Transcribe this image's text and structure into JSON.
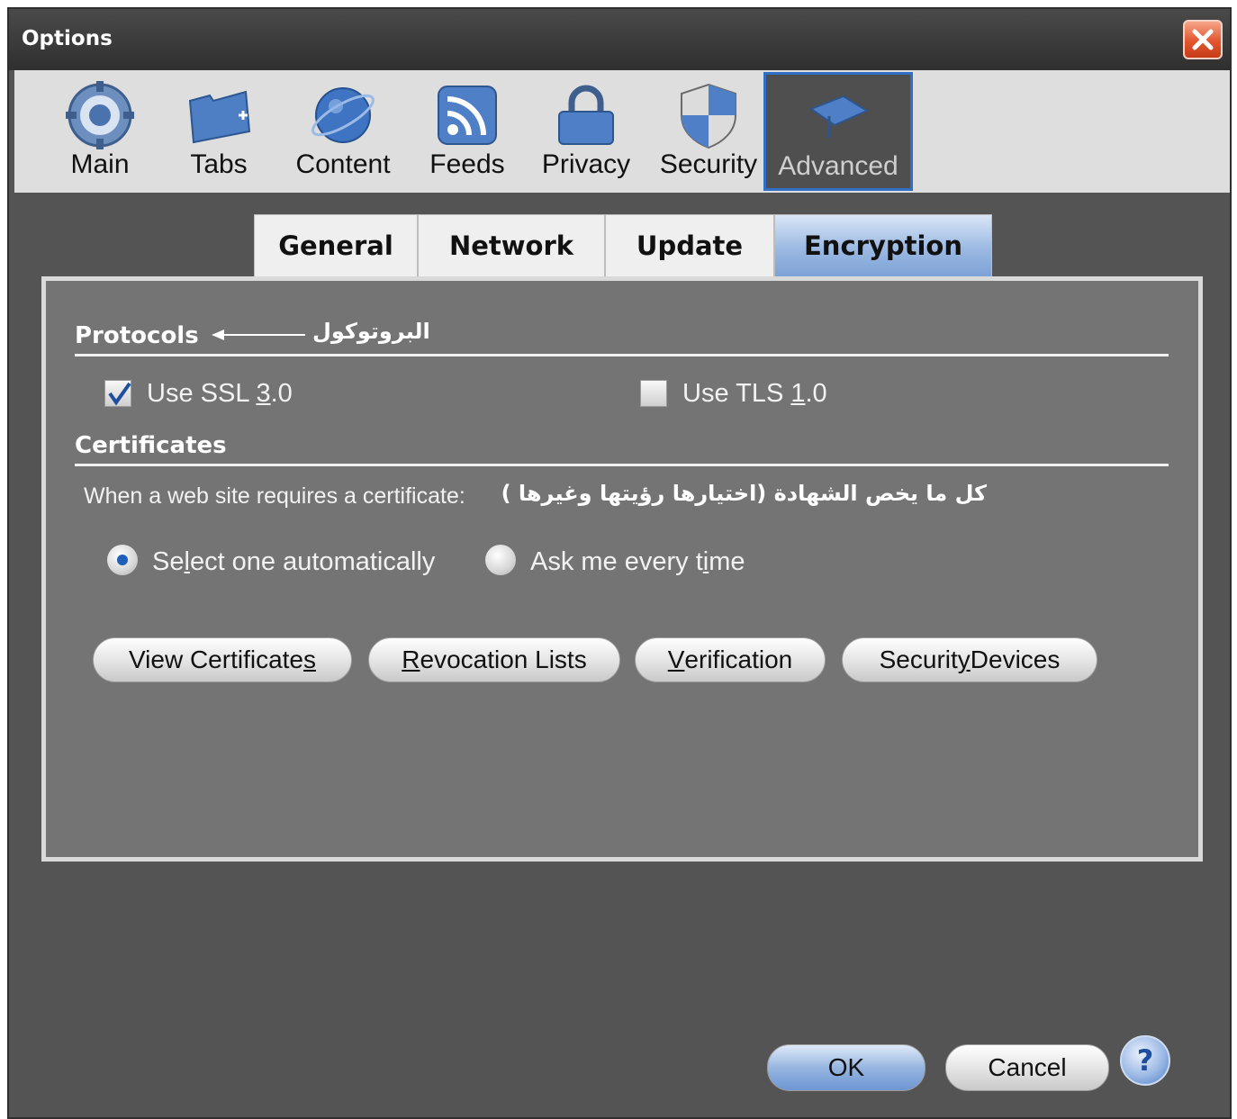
{
  "window": {
    "title": "Options"
  },
  "toolbar": {
    "items": [
      {
        "label": "Main",
        "icon": "gear-icon"
      },
      {
        "label": "Tabs",
        "icon": "folder-tab-icon"
      },
      {
        "label": "Content",
        "icon": "globe-icon"
      },
      {
        "label": "Feeds",
        "icon": "rss-icon"
      },
      {
        "label": "Privacy",
        "icon": "lock-icon"
      },
      {
        "label": "Security",
        "icon": "shield-icon"
      },
      {
        "label": "Advanced",
        "icon": "graduation-cap-icon",
        "selected": true
      }
    ]
  },
  "subtabs": {
    "items": [
      "General",
      "Network",
      "Update",
      "Encryption"
    ],
    "selected": "Encryption"
  },
  "protocols": {
    "heading": "Protocols",
    "annotation": "البروتوكول",
    "ssl": {
      "label_pre": "Use SSL ",
      "mnemonic": "3",
      "label_post": ".0",
      "checked": true
    },
    "tls": {
      "label_pre": "Use TLS ",
      "mnemonic": "1",
      "label_post": ".0",
      "checked": false
    }
  },
  "certificates": {
    "heading": "Certificates",
    "prompt": "When a web site requires a certificate:",
    "annotation": "كل ما يخص الشهادة (اختيارها رؤيتها وغيرها )",
    "auto": {
      "pre": "Se",
      "mnemonic": "l",
      "post": "ect one automatically",
      "selected": true
    },
    "ask": {
      "pre": "Ask me every t",
      "mnemonic": "i",
      "post": "me",
      "selected": false
    }
  },
  "buttons": {
    "view_certs": {
      "pre": "View Certificate",
      "mnemonic": "s",
      "post": ""
    },
    "revocation": {
      "pre": "",
      "mnemonic": "R",
      "post": "evocation Lists"
    },
    "verification": {
      "pre": "",
      "mnemonic": "V",
      "post": "erification"
    },
    "security_devices": {
      "pre": "Securit",
      "mnemonic": "y",
      "post": " Devices"
    }
  },
  "footer": {
    "ok": "OK",
    "cancel": "Cancel",
    "help": "?"
  },
  "colors": {
    "accent": "#2f6fc6",
    "window_bg": "#545454",
    "panel_bg": "#747474",
    "close": "#e2562f"
  }
}
